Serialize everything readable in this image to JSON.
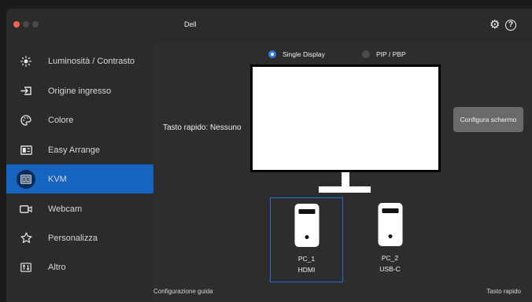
{
  "window": {
    "title": "Dell"
  },
  "titlebar": {
    "settings_icon": "gear-icon",
    "help_icon": "help-icon",
    "help_glyph": "?"
  },
  "sidebar": {
    "items": [
      {
        "label": "Luminosità / Contrasto",
        "icon": "brightness-icon",
        "active": false
      },
      {
        "label": "Origine ingresso",
        "icon": "input-source-icon",
        "active": false
      },
      {
        "label": "Colore",
        "icon": "palette-icon",
        "active": false
      },
      {
        "label": "Easy Arrange",
        "icon": "layout-icon",
        "active": false
      },
      {
        "label": "KVM",
        "icon": "kvm-icon",
        "active": true
      },
      {
        "label": "Webcam",
        "icon": "webcam-icon",
        "active": false
      },
      {
        "label": "Personalizza",
        "icon": "star-icon",
        "active": false
      },
      {
        "label": "Altro",
        "icon": "other-icon",
        "active": false
      }
    ]
  },
  "main": {
    "modes": [
      {
        "label": "Single Display",
        "selected": true
      },
      {
        "label": "PIP / PBP",
        "selected": false
      }
    ],
    "hotkey_label": "Tasto rapido: Nessuno",
    "configure_button": "Configura schermo",
    "pcs": [
      {
        "name": "PC_1",
        "port": "HDMI",
        "selected": true
      },
      {
        "name": "PC_2",
        "port": "USB-C",
        "selected": false
      }
    ],
    "footer_left": "Configurazione guidata",
    "footer_right": "Tasto rapido"
  },
  "colors": {
    "accent": "#1565c0",
    "selection_border": "#1f6fd6",
    "close_dot": "#ff5f57"
  }
}
